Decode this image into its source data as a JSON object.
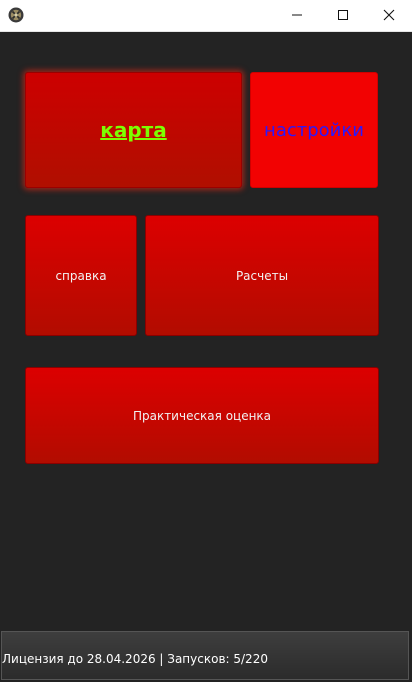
{
  "titlebar": {
    "app_icon": "app-emblem-icon",
    "minimize_icon": "minimize-icon",
    "maximize_icon": "maximize-icon",
    "close_icon": "close-icon"
  },
  "menu": {
    "map_label": "карта",
    "settings_label": "настройки",
    "help_label": "справка",
    "calculations_label": "Расчеты",
    "assessment_label": "Практическая оценка"
  },
  "status": {
    "text": "Лицензия до 28.04.2026 | Запусков: 5/220"
  },
  "colors": {
    "background": "#232323",
    "tile_red": "#dc0000",
    "settings_red": "#f20202",
    "map_text": "#7cff00",
    "settings_text": "#2a18ff"
  }
}
